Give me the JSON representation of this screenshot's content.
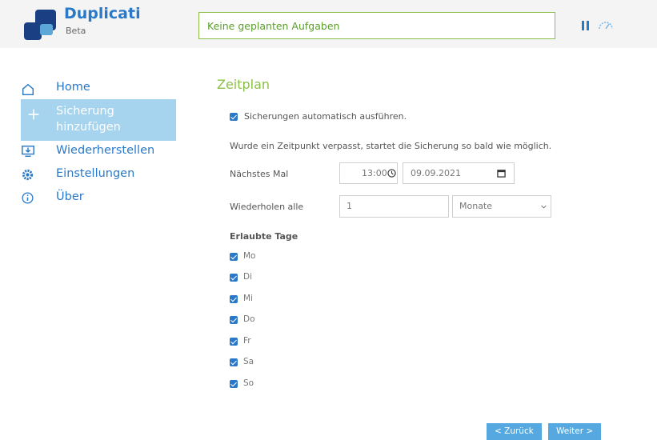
{
  "header": {
    "brand": "Duplicati",
    "brand_sub": "Beta",
    "status": "Keine geplanten Aufgaben"
  },
  "sidebar": {
    "items": [
      {
        "label": "Home",
        "icon": "home-icon"
      },
      {
        "label": "Sicherung hinzufügen",
        "label_line1": "Sicherung",
        "label_line2": "hinzufügen",
        "icon": "plus-icon",
        "active": true
      },
      {
        "label": "Wiederherstellen",
        "icon": "restore-icon"
      },
      {
        "label": "Einstellungen",
        "icon": "gear-icon"
      },
      {
        "label": "Über",
        "icon": "info-icon"
      }
    ]
  },
  "schedule": {
    "title": "Zeitplan",
    "auto_run_label": "Sicherungen automatisch ausführen.",
    "auto_run_checked": true,
    "missed_note": "Wurde ein Zeitpunkt verpasst, startet die Sicherung so bald wie möglich.",
    "next_time_label": "Nächstes Mal",
    "next_time_value": "13:00",
    "next_date_value": "09.09.2021",
    "repeat_label": "Wiederholen alle",
    "repeat_value": "1",
    "repeat_unit": "Monate",
    "allowed_days_label": "Erlaubte Tage",
    "days": [
      "Mo",
      "Di",
      "Mi",
      "Do",
      "Fr",
      "Sa",
      "So"
    ]
  },
  "buttons": {
    "back": "< Zurück",
    "next": "Weiter >"
  },
  "colors": {
    "accent_blue": "#2a78c8",
    "accent_green": "#8cbf4a",
    "nav_active_bg": "#a6d3ee",
    "button_bg": "#55a9e0"
  }
}
